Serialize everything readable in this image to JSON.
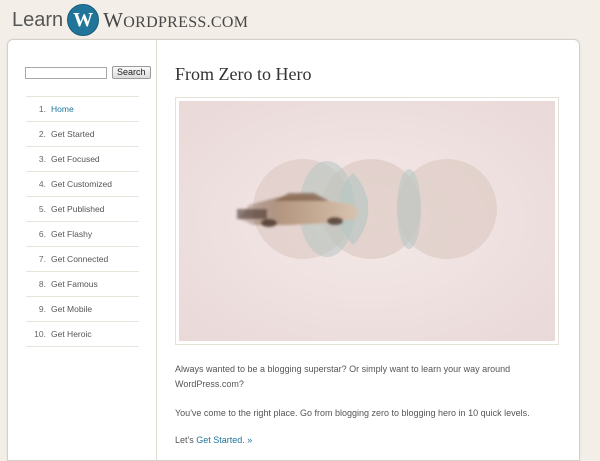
{
  "header": {
    "logo_learn": "Learn",
    "logo_w": "W",
    "logo_wordpress_big": "W",
    "logo_wordpress_rest": "ORDPRESS",
    "logo_dotcom": ".COM"
  },
  "search": {
    "value": "",
    "button_label": "Search"
  },
  "nav": [
    {
      "num": "1.",
      "label": "Home",
      "active": true
    },
    {
      "num": "2.",
      "label": "Get Started"
    },
    {
      "num": "3.",
      "label": "Get Focused"
    },
    {
      "num": "4.",
      "label": "Get Customized"
    },
    {
      "num": "5.",
      "label": "Get Published"
    },
    {
      "num": "6.",
      "label": "Get Flashy"
    },
    {
      "num": "7.",
      "label": "Get Connected"
    },
    {
      "num": "8.",
      "label": "Get Famous"
    },
    {
      "num": "9.",
      "label": "Get Mobile"
    },
    {
      "num": "10.",
      "label": "Get Heroic"
    }
  ],
  "main": {
    "title": "From Zero to Hero",
    "para1": "Always wanted to be a blogging superstar? Or simply want to learn your way around WordPress.com?",
    "para2": "You've come to the right place. Go from blogging zero to blogging hero in 10 quick levels.",
    "para3_prefix": "Let's ",
    "para3_link": "Get Started. »"
  },
  "colors": {
    "link": "#21759b",
    "background": "#f3efe8",
    "hero_background": "#f1e4e2"
  }
}
